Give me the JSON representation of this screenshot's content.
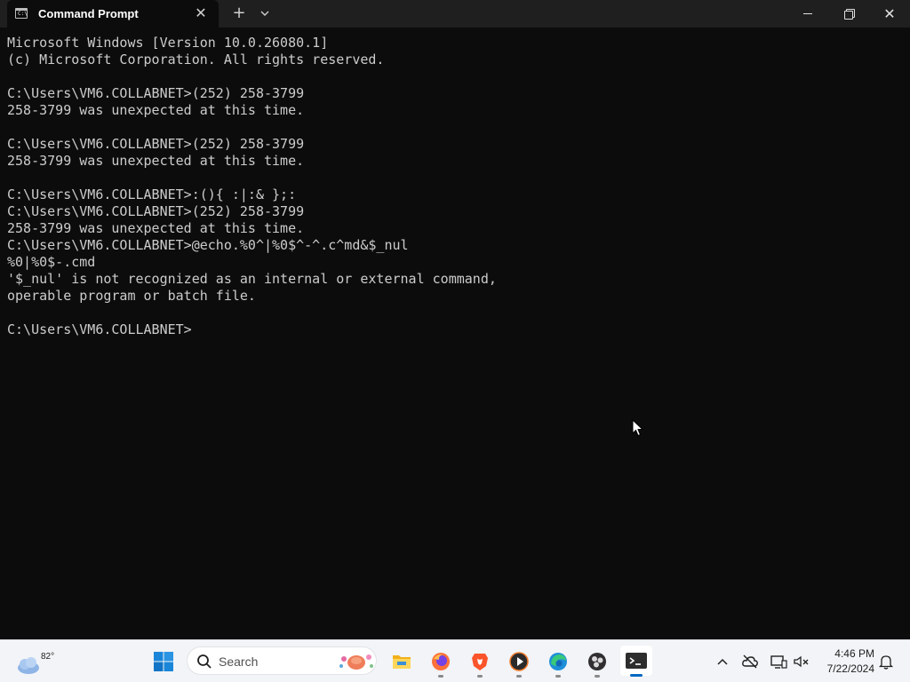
{
  "window": {
    "tab_title": "Command Prompt",
    "tab_icon_glyph": "C:\\",
    "new_tab_glyph": "+",
    "close_glyph": "✕",
    "window_close_glyph": "✕"
  },
  "console": {
    "lines": [
      "Microsoft Windows [Version 10.0.26080.1]",
      "(c) Microsoft Corporation. All rights reserved.",
      "",
      "C:\\Users\\VM6.COLLABNET>(252) 258-3799",
      "258-3799 was unexpected at this time.",
      "",
      "C:\\Users\\VM6.COLLABNET>(252) 258-3799",
      "258-3799 was unexpected at this time.",
      "",
      "C:\\Users\\VM6.COLLABNET>:(){ :|:& };:",
      "C:\\Users\\VM6.COLLABNET>(252) 258-3799",
      "258-3799 was unexpected at this time.",
      "C:\\Users\\VM6.COLLABNET>@echo.%0^|%0$^-^.c^md&$_nul",
      "%0|%0$-.cmd",
      "'$_nul' is not recognized as an internal or external command,",
      "operable program or batch file.",
      "",
      "C:\\Users\\VM6.COLLABNET>"
    ],
    "text_color": "#cccccc",
    "background": "#0c0c0c"
  },
  "taskbar": {
    "weather_temp": "82°",
    "search_label": "Search",
    "apps": [
      {
        "name": "file-explorer-icon",
        "running": false,
        "active": false
      },
      {
        "name": "firefox-icon",
        "running": true,
        "active": false
      },
      {
        "name": "brave-icon",
        "running": true,
        "active": false
      },
      {
        "name": "media-player-icon",
        "running": true,
        "active": false
      },
      {
        "name": "edge-icon",
        "running": true,
        "active": false
      },
      {
        "name": "obs-icon",
        "running": true,
        "active": false
      },
      {
        "name": "terminal-icon",
        "running": true,
        "active": true
      }
    ],
    "clock_time": "4:46 PM",
    "clock_date": "7/22/2024",
    "accent": "#0067c0"
  }
}
